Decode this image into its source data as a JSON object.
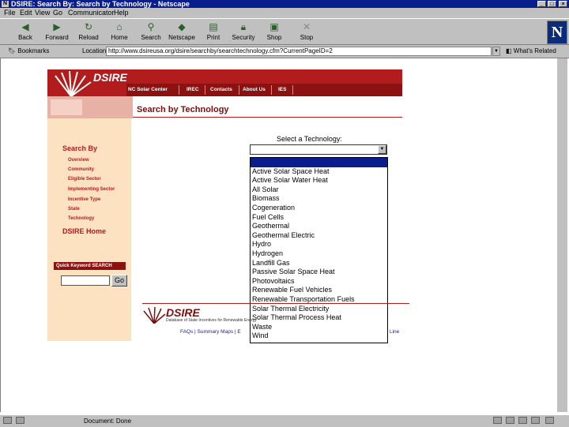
{
  "window": {
    "title": "DSIRE: Search By: Search by Technology - Netscape",
    "minimize": "_",
    "maximize": "□",
    "close": "×"
  },
  "menu": [
    "File",
    "Edit",
    "View",
    "Go",
    "Communicator",
    "Help"
  ],
  "toolbar": [
    "Back",
    "Forward",
    "Reload",
    "Home",
    "Search",
    "Netscape",
    "Print",
    "Security",
    "Shop",
    "Stop"
  ],
  "location": {
    "bookmarks": "Bookmarks",
    "label": "Location:",
    "url": "http://www.dsireusa.org/dsire/searchby/searchtechnology.cfm?CurrentPageID=2",
    "related": "What's Related"
  },
  "site": {
    "logo": "DSIRE",
    "nav": [
      "NC Solar Center",
      "IREC",
      "Contacts",
      "About Us",
      "IES"
    ],
    "page_title": "Search by Technology",
    "left_heading": "Search By",
    "left_links": [
      "Overview",
      "Community",
      "Eligible Sector",
      "Implementing Sector",
      "Incentive Type",
      "State",
      "Technology"
    ],
    "home_link": "DSIRE Home",
    "quick_search_label": "Quick Keyword SEARCH",
    "go_button": "Go",
    "select_label": "Select a Technology:",
    "options": [
      "",
      "Active Solar Space Heat",
      "Active Solar Water Heat",
      "All Solar",
      "Biomass",
      "Cogeneration",
      "Fuel Cells",
      "Geothermal",
      "Geothermal Electric",
      "Hydro",
      "Hydrogen",
      "Landfill Gas",
      "Passive Solar Space Heat",
      "Photovoltaics",
      "Renewable Fuel Vehicles",
      "Renewable Transportation Fuels",
      "Solar Thermal Electricity",
      "Solar Thermal Process Heat",
      "Waste",
      "Wind"
    ],
    "footer_logo": "DSIRE",
    "footer_tagline": "Database of State Incentives for Renewable Energy",
    "footer_links": "FAQs | Summary Maps | E",
    "footer_links_end": "Line"
  },
  "status": {
    "text": "Document: Done"
  }
}
